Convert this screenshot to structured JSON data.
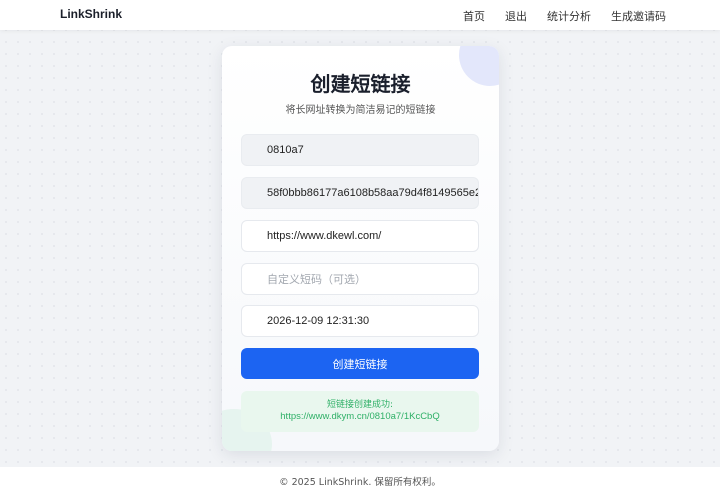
{
  "nav": {
    "brand": "LinkShrink",
    "links": [
      "首页",
      "退出",
      "统计分析",
      "生成邀请码"
    ]
  },
  "card": {
    "title": "创建短链接",
    "subtitle": "将长网址转换为简洁易记的短链接",
    "fields": {
      "user_code": "0810a7",
      "token": "58f0bbb86177a6108b58aa79d4f8149565e2",
      "long_url": "https://www.dkewl.com/",
      "custom_code_placeholder": "自定义短码（可选）",
      "expire_time": "2026-12-09 12:31:30"
    },
    "submit_label": "创建短链接",
    "result": {
      "message": "短链接创建成功:",
      "url": "https://www.dkym.cn/0810a7/1KcCbQ"
    }
  },
  "footer": {
    "text": "© 2025 LinkShrink. 保留所有权利。"
  },
  "colors": {
    "primary": "#1c64f2",
    "success": "#2fb067",
    "success_bg": "#e9f7ee"
  }
}
